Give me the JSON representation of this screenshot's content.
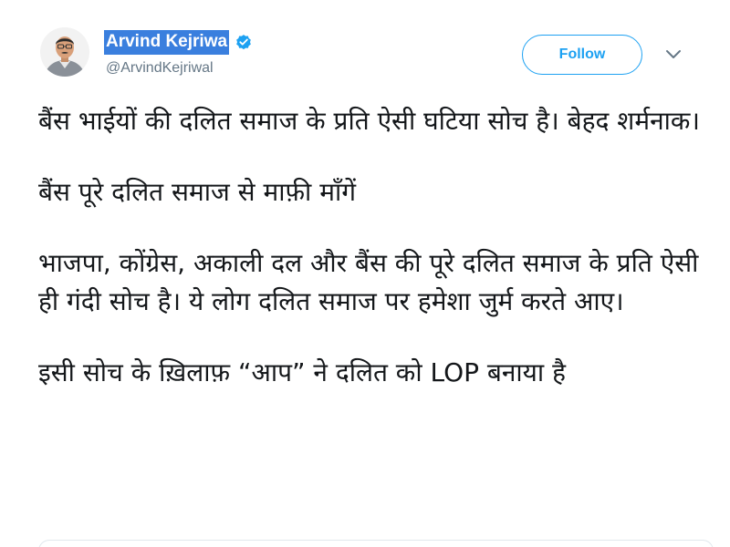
{
  "author": {
    "display_name": "Arvind Kejriwa",
    "handle": "@ArvindKejriwal",
    "verified": true,
    "avatar_icon": "profile-photo"
  },
  "actions": {
    "follow_label": "Follow",
    "more_icon": "chevron-down-icon"
  },
  "tweet": {
    "paragraphs": [
      "बैंस भाईयों की दलित समाज के प्रति ऐसी घटिया सोच है। बेहद शर्मनाक।",
      "बैंस पूरे दलित समाज से माफ़ी माँगें",
      "भाजपा, कोंग्रेस, अकाली दल और बैंस की पूरे दलित समाज के प्रति ऐसी ही गंदी सोच है। ये लोग दलित समाज पर हमेशा जुर्म करते आए।",
      "इसी सोच के ख़िलाफ़ “आप” ने दलित को LOP बनाया है"
    ]
  },
  "colors": {
    "accent": "#1da1f2",
    "name_highlight": "#3a7fde",
    "text": "#14171a",
    "secondary_text": "#657786"
  }
}
